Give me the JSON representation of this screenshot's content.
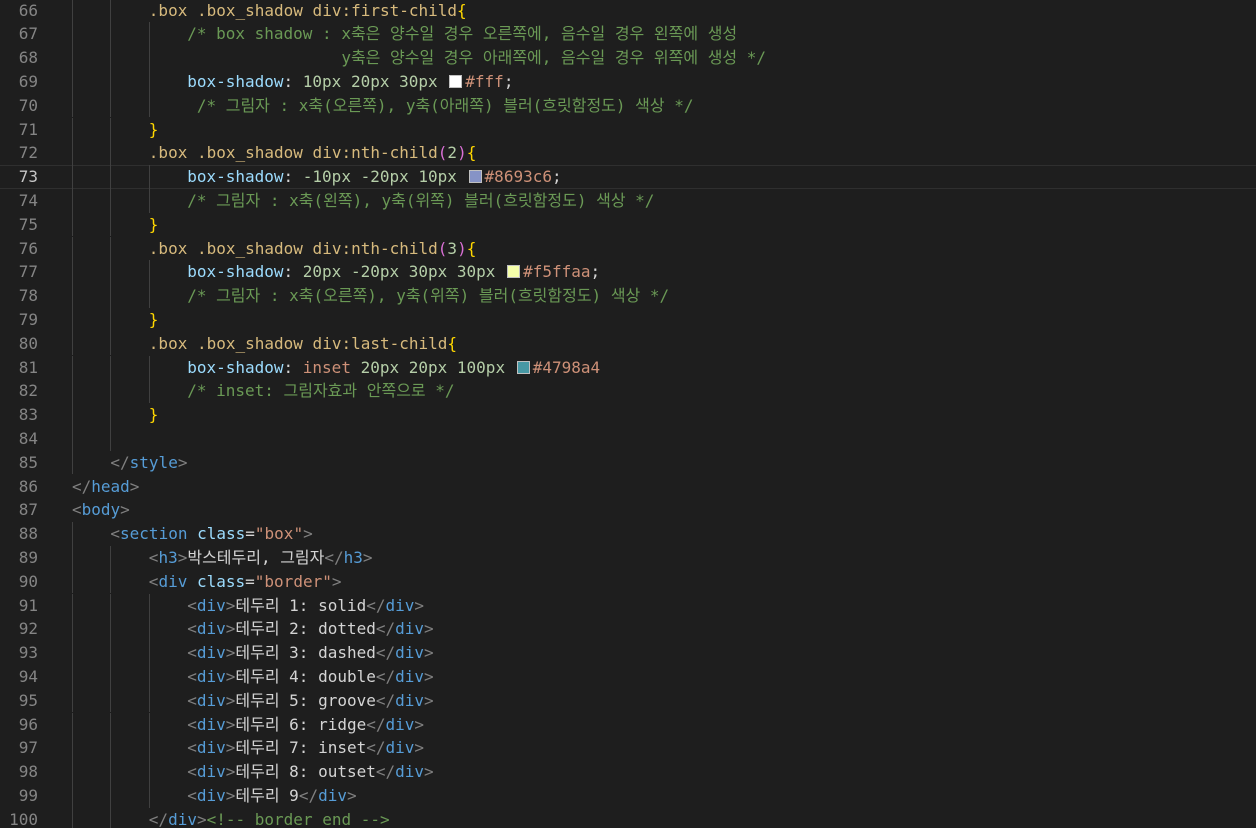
{
  "editor": {
    "current_line": 73,
    "lines": [
      {
        "n": "66",
        "indent": 2,
        "tokens": [
          {
            "t": ".box .box_shadow div:first-child",
            "c": "sel"
          },
          {
            "t": "{",
            "c": "b1"
          }
        ]
      },
      {
        "n": "67",
        "indent": 3,
        "tokens": [
          {
            "t": "/* box shadow : x축은 양수일 경우 오른쪽에, 음수일 경우 왼쪽에 생성",
            "c": "com"
          }
        ]
      },
      {
        "n": "68",
        "indent": 3,
        "tokens": [
          {
            "t": "                y축은 양수일 경우 아래쪽에, 음수일 경우 위쪽에 생성 */",
            "c": "com"
          }
        ]
      },
      {
        "n": "69",
        "indent": 3,
        "tokens": [
          {
            "t": "box-shadow",
            "c": "prop"
          },
          {
            "t": ": ",
            "c": "text"
          },
          {
            "t": "10px 20px 30px ",
            "c": "num"
          },
          {
            "sw": "#ffffff"
          },
          {
            "t": "#fff",
            "c": "str"
          },
          {
            "t": ";",
            "c": "text"
          }
        ]
      },
      {
        "n": "70",
        "indent": 3,
        "tokens": [
          {
            "t": " /* 그림자 : x축(오른쪽), y축(아래쪽) 블러(흐릿함정도) 색상 */",
            "c": "com"
          }
        ]
      },
      {
        "n": "71",
        "indent": 2,
        "tokens": [
          {
            "t": "}",
            "c": "b1"
          }
        ]
      },
      {
        "n": "72",
        "indent": 2,
        "tokens": [
          {
            "t": ".box .box_shadow div:nth-child",
            "c": "sel"
          },
          {
            "t": "(",
            "c": "b2"
          },
          {
            "t": "2",
            "c": "num"
          },
          {
            "t": ")",
            "c": "b2"
          },
          {
            "t": "{",
            "c": "b1"
          }
        ]
      },
      {
        "n": "73",
        "indent": 3,
        "tokens": [
          {
            "t": "box-shadow",
            "c": "prop"
          },
          {
            "t": ": ",
            "c": "text"
          },
          {
            "t": "-10px -20px 10px ",
            "c": "num"
          },
          {
            "sw": "#8693c6"
          },
          {
            "t": "#8693c6",
            "c": "str"
          },
          {
            "t": ";",
            "c": "text"
          }
        ]
      },
      {
        "n": "74",
        "indent": 3,
        "tokens": [
          {
            "t": "/* 그림자 : x축(왼쪽), y축(위쪽) 블러(흐릿함정도) 색상 */",
            "c": "com"
          }
        ]
      },
      {
        "n": "75",
        "indent": 2,
        "tokens": [
          {
            "t": "}",
            "c": "b1"
          }
        ]
      },
      {
        "n": "76",
        "indent": 2,
        "tokens": [
          {
            "t": ".box .box_shadow div:nth-child",
            "c": "sel"
          },
          {
            "t": "(",
            "c": "b2"
          },
          {
            "t": "3",
            "c": "num"
          },
          {
            "t": ")",
            "c": "b2"
          },
          {
            "t": "{",
            "c": "b1"
          }
        ]
      },
      {
        "n": "77",
        "indent": 3,
        "tokens": [
          {
            "t": "box-shadow",
            "c": "prop"
          },
          {
            "t": ": ",
            "c": "text"
          },
          {
            "t": "20px -20px 30px 30px ",
            "c": "num"
          },
          {
            "sw": "#f5ffaa"
          },
          {
            "t": "#f5ffaa",
            "c": "str"
          },
          {
            "t": ";",
            "c": "text"
          }
        ]
      },
      {
        "n": "78",
        "indent": 3,
        "tokens": [
          {
            "t": "/* 그림자 : x축(오른쪽), y축(위쪽) 블러(흐릿함정도) 색상 */",
            "c": "com"
          }
        ]
      },
      {
        "n": "79",
        "indent": 2,
        "tokens": [
          {
            "t": "}",
            "c": "b1"
          }
        ]
      },
      {
        "n": "80",
        "indent": 2,
        "tokens": [
          {
            "t": ".box .box_shadow div:last-child",
            "c": "sel"
          },
          {
            "t": "{",
            "c": "b1"
          }
        ]
      },
      {
        "n": "81",
        "indent": 3,
        "tokens": [
          {
            "t": "box-shadow",
            "c": "prop"
          },
          {
            "t": ": ",
            "c": "text"
          },
          {
            "t": "inset ",
            "c": "str"
          },
          {
            "t": "20px 20px 100px ",
            "c": "num"
          },
          {
            "sw": "#4798a4"
          },
          {
            "t": "#4798a4",
            "c": "str"
          }
        ]
      },
      {
        "n": "82",
        "indent": 3,
        "tokens": [
          {
            "t": "/* inset: 그림자효과 안쪽으로 */",
            "c": "com"
          }
        ]
      },
      {
        "n": "83",
        "indent": 2,
        "tokens": [
          {
            "t": "}",
            "c": "b1"
          }
        ]
      },
      {
        "n": "84",
        "indent": 2,
        "tokens": []
      },
      {
        "n": "85",
        "indent": 1,
        "tokens": [
          {
            "t": "</",
            "c": "punc"
          },
          {
            "t": "style",
            "c": "tag"
          },
          {
            "t": ">",
            "c": "punc"
          }
        ]
      },
      {
        "n": "86",
        "indent": 0,
        "tokens": [
          {
            "t": "</",
            "c": "punc"
          },
          {
            "t": "head",
            "c": "tag"
          },
          {
            "t": ">",
            "c": "punc"
          }
        ]
      },
      {
        "n": "87",
        "indent": 0,
        "tokens": [
          {
            "t": "<",
            "c": "punc"
          },
          {
            "t": "body",
            "c": "tag"
          },
          {
            "t": ">",
            "c": "punc"
          }
        ]
      },
      {
        "n": "88",
        "indent": 1,
        "tokens": [
          {
            "t": "<",
            "c": "punc"
          },
          {
            "t": "section",
            "c": "tag"
          },
          {
            "t": " class",
            "c": "attr"
          },
          {
            "t": "=",
            "c": "text"
          },
          {
            "t": "\"box\"",
            "c": "str"
          },
          {
            "t": ">",
            "c": "punc"
          }
        ]
      },
      {
        "n": "89",
        "indent": 2,
        "tokens": [
          {
            "t": "<",
            "c": "punc"
          },
          {
            "t": "h3",
            "c": "tag"
          },
          {
            "t": ">",
            "c": "punc"
          },
          {
            "t": "박스테두리, 그림자",
            "c": "text"
          },
          {
            "t": "</",
            "c": "punc"
          },
          {
            "t": "h3",
            "c": "tag"
          },
          {
            "t": ">",
            "c": "punc"
          }
        ]
      },
      {
        "n": "90",
        "indent": 2,
        "tokens": [
          {
            "t": "<",
            "c": "punc"
          },
          {
            "t": "div",
            "c": "tag"
          },
          {
            "t": " class",
            "c": "attr"
          },
          {
            "t": "=",
            "c": "text"
          },
          {
            "t": "\"border\"",
            "c": "str"
          },
          {
            "t": ">",
            "c": "punc"
          }
        ]
      },
      {
        "n": "91",
        "indent": 3,
        "tokens": [
          {
            "t": "<",
            "c": "punc"
          },
          {
            "t": "div",
            "c": "tag"
          },
          {
            "t": ">",
            "c": "punc"
          },
          {
            "t": "테두리 1: solid",
            "c": "text"
          },
          {
            "t": "</",
            "c": "punc"
          },
          {
            "t": "div",
            "c": "tag"
          },
          {
            "t": ">",
            "c": "punc"
          }
        ]
      },
      {
        "n": "92",
        "indent": 3,
        "tokens": [
          {
            "t": "<",
            "c": "punc"
          },
          {
            "t": "div",
            "c": "tag"
          },
          {
            "t": ">",
            "c": "punc"
          },
          {
            "t": "테두리 2: dotted",
            "c": "text"
          },
          {
            "t": "</",
            "c": "punc"
          },
          {
            "t": "div",
            "c": "tag"
          },
          {
            "t": ">",
            "c": "punc"
          }
        ]
      },
      {
        "n": "93",
        "indent": 3,
        "tokens": [
          {
            "t": "<",
            "c": "punc"
          },
          {
            "t": "div",
            "c": "tag"
          },
          {
            "t": ">",
            "c": "punc"
          },
          {
            "t": "테두리 3: dashed",
            "c": "text"
          },
          {
            "t": "</",
            "c": "punc"
          },
          {
            "t": "div",
            "c": "tag"
          },
          {
            "t": ">",
            "c": "punc"
          }
        ]
      },
      {
        "n": "94",
        "indent": 3,
        "tokens": [
          {
            "t": "<",
            "c": "punc"
          },
          {
            "t": "div",
            "c": "tag"
          },
          {
            "t": ">",
            "c": "punc"
          },
          {
            "t": "테두리 4: double",
            "c": "text"
          },
          {
            "t": "</",
            "c": "punc"
          },
          {
            "t": "div",
            "c": "tag"
          },
          {
            "t": ">",
            "c": "punc"
          }
        ]
      },
      {
        "n": "95",
        "indent": 3,
        "tokens": [
          {
            "t": "<",
            "c": "punc"
          },
          {
            "t": "div",
            "c": "tag"
          },
          {
            "t": ">",
            "c": "punc"
          },
          {
            "t": "테두리 5: groove",
            "c": "text"
          },
          {
            "t": "</",
            "c": "punc"
          },
          {
            "t": "div",
            "c": "tag"
          },
          {
            "t": ">",
            "c": "punc"
          }
        ]
      },
      {
        "n": "96",
        "indent": 3,
        "tokens": [
          {
            "t": "<",
            "c": "punc"
          },
          {
            "t": "div",
            "c": "tag"
          },
          {
            "t": ">",
            "c": "punc"
          },
          {
            "t": "테두리 6: ridge",
            "c": "text"
          },
          {
            "t": "</",
            "c": "punc"
          },
          {
            "t": "div",
            "c": "tag"
          },
          {
            "t": ">",
            "c": "punc"
          }
        ]
      },
      {
        "n": "97",
        "indent": 3,
        "tokens": [
          {
            "t": "<",
            "c": "punc"
          },
          {
            "t": "div",
            "c": "tag"
          },
          {
            "t": ">",
            "c": "punc"
          },
          {
            "t": "테두리 7: inset",
            "c": "text"
          },
          {
            "t": "</",
            "c": "punc"
          },
          {
            "t": "div",
            "c": "tag"
          },
          {
            "t": ">",
            "c": "punc"
          }
        ]
      },
      {
        "n": "98",
        "indent": 3,
        "tokens": [
          {
            "t": "<",
            "c": "punc"
          },
          {
            "t": "div",
            "c": "tag"
          },
          {
            "t": ">",
            "c": "punc"
          },
          {
            "t": "테두리 8: outset",
            "c": "text"
          },
          {
            "t": "</",
            "c": "punc"
          },
          {
            "t": "div",
            "c": "tag"
          },
          {
            "t": ">",
            "c": "punc"
          }
        ]
      },
      {
        "n": "99",
        "indent": 3,
        "tokens": [
          {
            "t": "<",
            "c": "punc"
          },
          {
            "t": "div",
            "c": "tag"
          },
          {
            "t": ">",
            "c": "punc"
          },
          {
            "t": "테두리 9",
            "c": "text"
          },
          {
            "t": "</",
            "c": "punc"
          },
          {
            "t": "div",
            "c": "tag"
          },
          {
            "t": ">",
            "c": "punc"
          }
        ]
      },
      {
        "n": "100",
        "indent": 2,
        "tokens": [
          {
            "t": "</",
            "c": "punc"
          },
          {
            "t": "div",
            "c": "tag"
          },
          {
            "t": ">",
            "c": "punc"
          },
          {
            "t": "<!-- border end -->",
            "c": "com"
          }
        ]
      }
    ]
  }
}
